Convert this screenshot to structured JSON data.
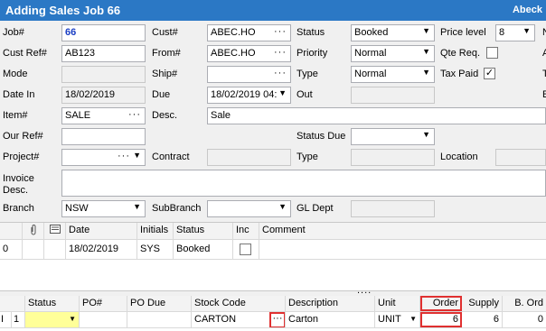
{
  "window": {
    "title": "Adding Sales Job 66",
    "right_text": "Abeck"
  },
  "form": {
    "job_label": "Job#",
    "job_value": "66",
    "custref_label": "Cust Ref#",
    "custref_value": "AB123",
    "mode_label": "Mode",
    "datein_label": "Date In",
    "datein_value": "18/02/2019",
    "item_label": "Item#",
    "item_value": "SALE",
    "ourref_label": "Our Ref#",
    "project_label": "Project#",
    "invoice_label_1": "Invoice",
    "invoice_label_2": "Desc.",
    "branch_label": "Branch",
    "branch_value": "NSW",
    "cust_label": "Cust#",
    "cust_value": "ABEC.HO",
    "from_label": "From#",
    "from_value": "ABEC.HO",
    "ship_label": "Ship#",
    "due_label": "Due",
    "due_value": "18/02/2019 04:",
    "desc_label": "Desc.",
    "desc_value": "Sale",
    "contract_label": "Contract",
    "subbranch_label": "SubBranch",
    "status_label": "Status",
    "status_value": "Booked",
    "priority_label": "Priority",
    "priority_value": "Normal",
    "type_label": "Type",
    "type_value": "Normal",
    "out_label": "Out",
    "statusdue_label": "Status Due",
    "type2_label": "Type",
    "gldept_label": "GL Dept",
    "pricelevel_label": "Price level",
    "pricelevel_value": "8",
    "qtereq_label": "Qte Req.",
    "taxpaid_label": "Tax Paid",
    "taxpaid_check": "✓",
    "location_label": "Location",
    "edge_labels": [
      "N",
      "A",
      "T",
      "E"
    ]
  },
  "status_grid": {
    "headers": [
      "Date",
      "Initials",
      "Status",
      "Inc",
      "Comment"
    ],
    "rows": [
      {
        "num": "0",
        "date": "18/02/2019",
        "initials": "SYS",
        "status": "Booked"
      }
    ]
  },
  "stock_grid": {
    "headers": [
      "Status",
      "PO#",
      "PO Due",
      "Stock Code",
      "Description",
      "Unit",
      "Order",
      "Supply",
      "B. Ord"
    ],
    "rows": [
      {
        "marker": "I",
        "num": "1",
        "stock_code": "CARTON",
        "description": "Carton",
        "unit": "UNIT",
        "order": "6",
        "supply": "6",
        "bord": "0"
      }
    ]
  },
  "icons": [
    "paperclip-icon",
    "note-icon",
    "ellipsis-icon",
    "dropdown-arrow-icon",
    "splitter-grip-icon"
  ],
  "colors": {
    "titlebar": "#2b78c5",
    "job_number": "#1a3ec4",
    "highlight": "#e03030",
    "selected_status": "#ffff99"
  }
}
